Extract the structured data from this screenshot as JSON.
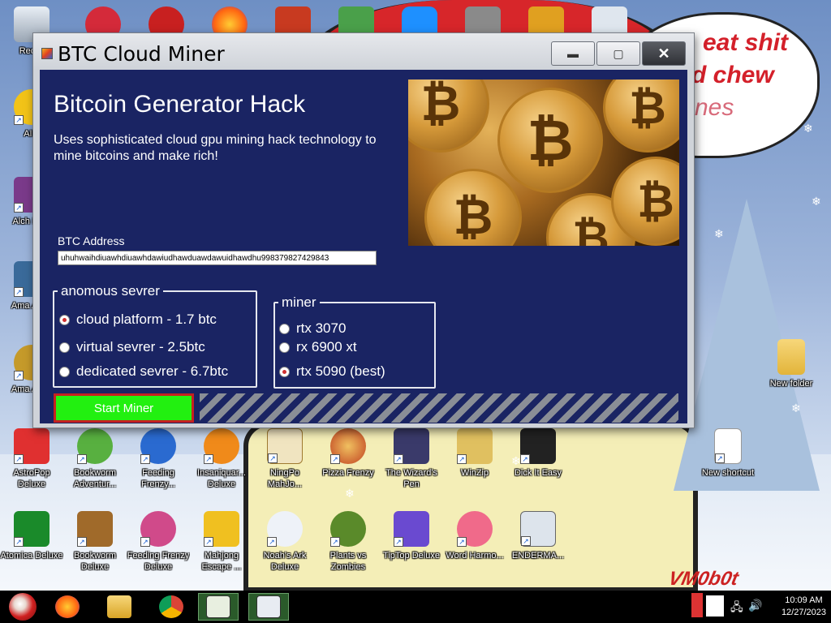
{
  "window": {
    "title": "BTC Cloud Miner",
    "controls": {
      "minimize_icon": "minimize-icon",
      "maximize_icon": "maximize-icon",
      "close_icon": "close-icon"
    }
  },
  "app": {
    "heading": "Bitcoin Generator Hack",
    "description": "Uses sophisticated cloud gpu mining hack technology to mine bitcoins and make rich!",
    "address_label": "BTC Address",
    "address_value": "uhuhwaihdiuawhdiuawhdawiudhawduawdawuidhawdhu998379827429843",
    "server_group": {
      "legend": "anomous sevrer",
      "options": [
        "cloud platform - 1.7 btc",
        "virtual sevrer - 2.5btc",
        "dedicated sevrer - 6.7btc"
      ],
      "selected": 0
    },
    "miner_group": {
      "legend": "miner",
      "options": [
        "rtx 3070",
        "rx 6900 xt",
        "rtx 5090 (best)"
      ],
      "selected": 2
    },
    "start_label": "Start Miner",
    "accent_color": "#22f010",
    "background_color": "#1a2463"
  },
  "wallpaper": {
    "speech_lines": [
      "eat shit",
      "d chew",
      "nes"
    ],
    "watermark": "VM0b0t"
  },
  "desktop_icons": [
    {
      "label": "Recyc",
      "icon": "recycle-bin-icon"
    },
    {
      "label": "AIM",
      "icon": "aim-icon"
    },
    {
      "label": "Alch Delu",
      "icon": "alchemy-icon"
    },
    {
      "label": "Ama Adve",
      "icon": "amazing-adventures-icon"
    },
    {
      "label": "Ama Adve",
      "icon": "amazing-adventures-2-icon"
    },
    {
      "label": "New folder",
      "icon": "folder-icon"
    },
    {
      "label": "AstroPop Deluxe",
      "icon": "astropop-icon"
    },
    {
      "label": "Bookworm Adventur...",
      "icon": "bookworm-adventures-icon"
    },
    {
      "label": "Feeding Frenzy...",
      "icon": "feeding-frenzy-2-icon"
    },
    {
      "label": "Insaniquar... Deluxe",
      "icon": "insaniquarium-icon"
    },
    {
      "label": "NingPo MahJo...",
      "icon": "ningpo-mahjong-icon"
    },
    {
      "label": "Pizza Frenzy",
      "icon": "pizza-frenzy-icon"
    },
    {
      "label": "The Wizard's Pen",
      "icon": "wizards-pen-icon"
    },
    {
      "label": "WinZip",
      "icon": "winzip-icon"
    },
    {
      "label": "Dick It Easy",
      "icon": "dick-it-easy-icon"
    },
    {
      "label": "New shortcut",
      "icon": "new-shortcut-icon"
    },
    {
      "label": "Atomica Deluxe",
      "icon": "atomica-icon"
    },
    {
      "label": "Bookworm Deluxe",
      "icon": "bookworm-deluxe-icon"
    },
    {
      "label": "Feeding Frenzy Deluxe",
      "icon": "feeding-frenzy-deluxe-icon"
    },
    {
      "label": "Mahjong Escape ...",
      "icon": "mahjong-escape-icon"
    },
    {
      "label": "Noah's Ark Deluxe",
      "icon": "noahs-ark-icon"
    },
    {
      "label": "Plants vs Zombies",
      "icon": "plants-vs-zombies-icon"
    },
    {
      "label": "TipTop Deluxe",
      "icon": "tiptop-icon"
    },
    {
      "label": "Word Harmo...",
      "icon": "word-harmony-icon"
    },
    {
      "label": "ENDERMA...",
      "icon": "enderman-icon"
    }
  ],
  "taskbar": {
    "items": [
      "start-orb-icon",
      "firefox-icon",
      "file-explorer-icon",
      "chrome-icon",
      "notepad-app-icon",
      "btc-miner-taskbar-icon"
    ],
    "time": "10:09 AM",
    "date": "12/27/2023"
  }
}
